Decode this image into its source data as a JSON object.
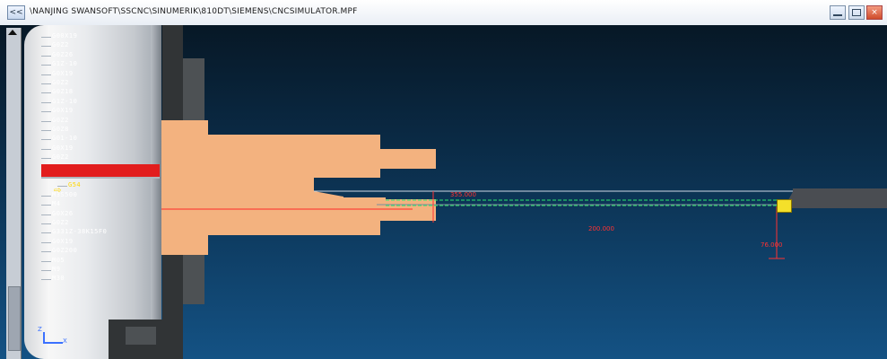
{
  "window": {
    "title": "\\NANJING SWANSOFT\\SSCNC\\SINUMERIK\\810DT\\SIEMENS\\CNCSIMULATOR.MPF",
    "back_label": "<<",
    "close_glyph": "×"
  },
  "program": {
    "lines": [
      "G00X19",
      "G0Z2",
      "G0Z26",
      "G1Z-10",
      "G0X19",
      "G0Z2",
      "G0Z18",
      "G1Z-10",
      "G0X19",
      "G0Z2",
      "G0Z8",
      "G01-10",
      "G0X19",
      "G0Z2",
      "G0X420",
      "G0Z200",
      "G54",
      "M3S500",
      "M4",
      "G0X26",
      "G0Z2",
      "G331Z-38K15F0",
      "G0X19",
      "G0Z200",
      "M05",
      "M9",
      "M30"
    ],
    "highlighted_line": 14,
    "current_line": 16
  },
  "dimensions": {
    "d1": "355.000",
    "d2": "200.000",
    "d3": "76.000"
  },
  "axes": {
    "x": "X",
    "y": "Z"
  },
  "colors": {
    "part": "#f3b27f",
    "centerline": "#ff2a2a",
    "toolpath": "#2ee56c",
    "tool_tip": "#f4e02a",
    "highlight": "#e21d1d"
  }
}
